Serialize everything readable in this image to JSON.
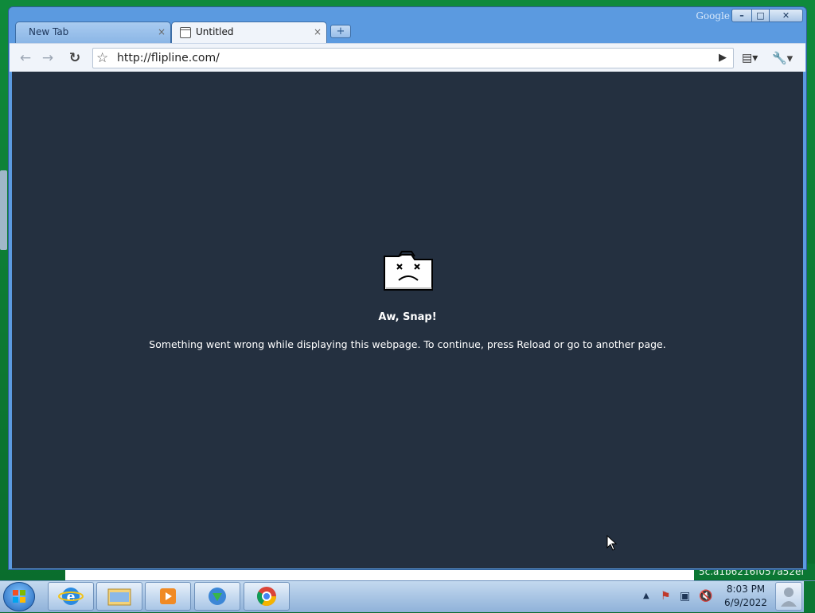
{
  "browser": {
    "brand_text": "Google",
    "tabs": [
      {
        "label": "New Tab",
        "close": "×"
      },
      {
        "label": "Untitled",
        "close": "×"
      }
    ],
    "new_tab_glyph": "+",
    "window_controls": {
      "minimize": "–",
      "maximize": "□",
      "close": "✕"
    }
  },
  "toolbar": {
    "back_glyph": "←",
    "forward_glyph": "→",
    "reload_glyph": "↻",
    "star_glyph": "☆",
    "url": "http://flipline.com/",
    "go_glyph": "▶",
    "page_menu_glyph": "▤▾",
    "wrench_glyph": "🔧▾"
  },
  "error_page": {
    "title": "Aw, Snap!",
    "message": "Something went wrong while displaying this webpage. To continue, press Reload or go to another page."
  },
  "taskbar": {
    "apps": [
      "internet-explorer-icon",
      "windows-explorer-icon",
      "media-player-icon",
      "internet-download-manager-icon",
      "chrome-icon"
    ],
    "tray_glyphs": {
      "show_hidden": "▲",
      "action_center": "⚑",
      "network": "▣",
      "volume": "🔇"
    },
    "time": "8:03 PM",
    "date": "6/9/2022"
  },
  "desktop": {
    "background_text": "5c.a1b6216f057a52ef"
  },
  "colors": {
    "desktop_green": "#0b7733",
    "window_frame": "#5b9ae0",
    "error_background": "#243040",
    "toolbar": "#f0f4fa"
  }
}
